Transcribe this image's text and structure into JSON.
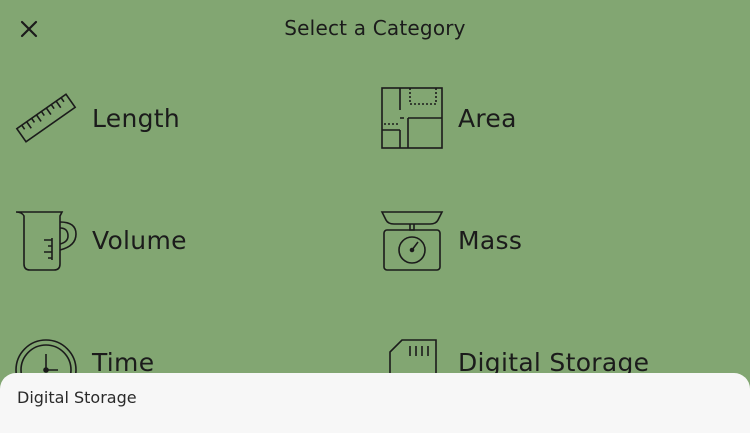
{
  "header": {
    "title": "Select a Category",
    "close_icon": "close-icon"
  },
  "categories": [
    {
      "label": "Length",
      "icon": "ruler-icon"
    },
    {
      "label": "Area",
      "icon": "floor-plan-icon"
    },
    {
      "label": "Volume",
      "icon": "measuring-cup-icon"
    },
    {
      "label": "Mass",
      "icon": "kitchen-scale-icon"
    },
    {
      "label": "Time",
      "icon": "clock-icon"
    },
    {
      "label": "Digital Storage",
      "icon": "sd-card-icon"
    }
  ],
  "bottom_sheet": {
    "text": "Digital Storage"
  },
  "colors": {
    "background": "#82a672",
    "foreground": "#1b1b1b",
    "sheet": "#f7f7f7"
  }
}
